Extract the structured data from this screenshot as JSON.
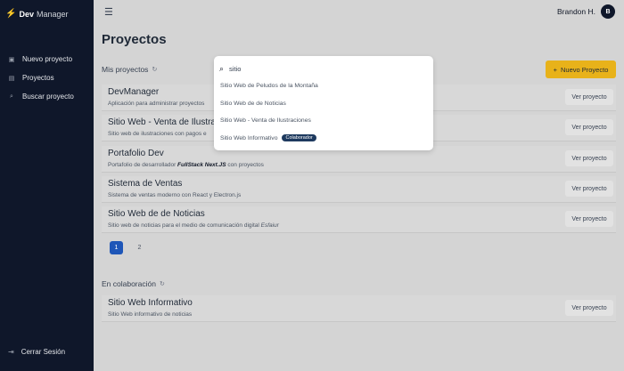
{
  "brand": {
    "icon": "devmanager-logo-icon",
    "name_bold": "Dev",
    "name_light": "Manager"
  },
  "sidebar": {
    "items": [
      {
        "label": "Nuevo proyecto",
        "icon": "new-project-icon"
      },
      {
        "label": "Proyectos",
        "icon": "projects-icon"
      },
      {
        "label": "Buscar proyecto",
        "icon": "search-icon"
      }
    ],
    "logout": "Cerrar Sesión"
  },
  "header": {
    "user_name": "Brandon H.",
    "avatar_initial": "B"
  },
  "page_title": "Proyectos",
  "my_projects": {
    "heading": "Mis proyectos",
    "new_button": "Nuevo Proyecto",
    "view_label": "Ver proyecto",
    "items": [
      {
        "name": "DevManager",
        "description": "Aplicación para administrar proyectos"
      },
      {
        "name": "Sitio Web - Venta de Ilustraci",
        "description": "Sitio web de ilustraciones con pagos e"
      },
      {
        "name": "Portafolio Dev",
        "desc_prefix": "Portafolio de desarrollador ",
        "desc_bold": "FullStack Next.JS",
        "desc_suffix": " con proyectos"
      },
      {
        "name": "Sistema de Ventas",
        "description": "Sistema de ventas moderno con React y Electron.js"
      },
      {
        "name": "Sitio Web de de Noticias",
        "desc_prefix": "Sitio web de noticias para el medio de comunicación digital ",
        "desc_italic": "Esfaiur"
      }
    ],
    "pagination": [
      "1",
      "2"
    ],
    "current_page": "1"
  },
  "collab": {
    "heading": "En colaboración",
    "items": [
      {
        "name": "Sitio Web Informativo",
        "description": "Sitio Web informativo de noticias"
      }
    ]
  },
  "search": {
    "value": "sitio",
    "results": [
      {
        "label": "Sitio Web de Peludos de la Montaña"
      },
      {
        "label": "Sitio Web de de Noticias"
      },
      {
        "label": "Sitio Web - Venta de Ilustraciones"
      },
      {
        "label": "Sitio Web Informativo",
        "tag": "Colaborador"
      }
    ]
  },
  "colors": {
    "sidebar": "#0f172a",
    "accent": "#e8b21a",
    "active_page": "#1e56b8",
    "tag": "#1e3a5f"
  }
}
